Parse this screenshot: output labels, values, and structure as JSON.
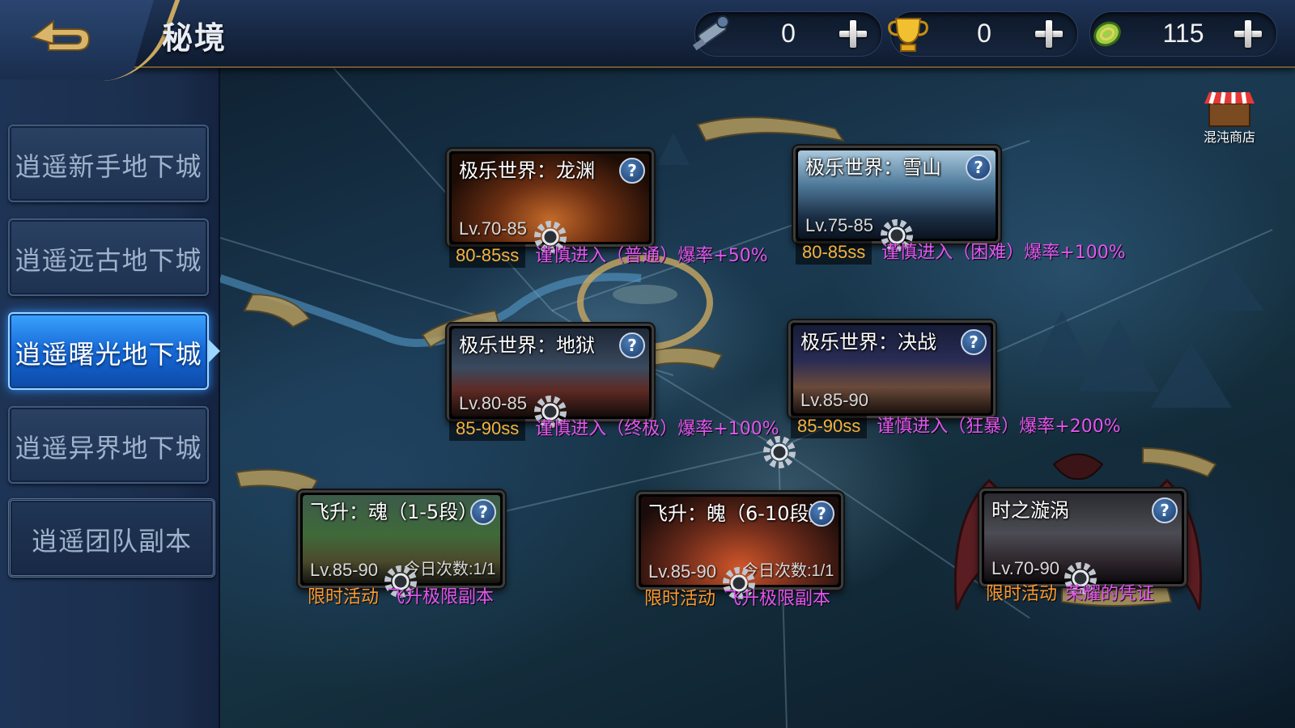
{
  "header": {
    "title": "秘境",
    "back_icon": "back-arrow-icon",
    "currencies": [
      {
        "icon": "telescope-icon",
        "value": "0"
      },
      {
        "icon": "gold-trophy-icon",
        "value": "0"
      },
      {
        "icon": "gold-coin-icon",
        "value": "115"
      }
    ]
  },
  "sidebar": {
    "items": [
      {
        "label": "逍遥新手地下城"
      },
      {
        "label": "逍遥远古地下城"
      },
      {
        "label": "逍遥曙光地下城",
        "active": true
      },
      {
        "label": "逍遥异界地下城"
      },
      {
        "label": "逍遥团队副本"
      }
    ]
  },
  "shop": {
    "label": "混沌商店",
    "icon": "shop-stall-icon"
  },
  "dungeons": [
    {
      "title": "极乐世界：龙渊",
      "level": "Lv.70-85",
      "range": "80-85ss",
      "note": "谨慎进入（普通）爆率+50%"
    },
    {
      "title": "极乐世界：雪山",
      "level": "Lv.75-85",
      "range": "80-85ss",
      "note": "谨慎进入（困难）爆率+100%"
    },
    {
      "title": "极乐世界：地狱",
      "level": "Lv.80-85",
      "range": "85-90ss",
      "note": "谨慎进入（终极）爆率+100%"
    },
    {
      "title": "极乐世界：决战",
      "level": "Lv.85-90",
      "range": "85-90ss",
      "note": "谨慎进入（狂暴）爆率+200%"
    },
    {
      "title": "飞升：魂（1-5段）",
      "level": "Lv.85-90",
      "daily": "今日次数:1/1",
      "event": "限时活动",
      "note": "飞升极限副本"
    },
    {
      "title": "飞升：魄（6-10段）",
      "level": "Lv.85-90",
      "daily": "今日次数:1/1",
      "event": "限时活动",
      "note": "飞升极限副本"
    },
    {
      "title": "时之漩涡",
      "level": "Lv.70-90",
      "event": "限时活动",
      "note": "荣耀的凭证"
    }
  ],
  "colors": {
    "accent_blue": "#1669d6",
    "range_orange": "#f7b23c",
    "note_magenta": "#e455f0",
    "event_orange": "#ff9a2e",
    "gold_trim": "#c9a860"
  }
}
